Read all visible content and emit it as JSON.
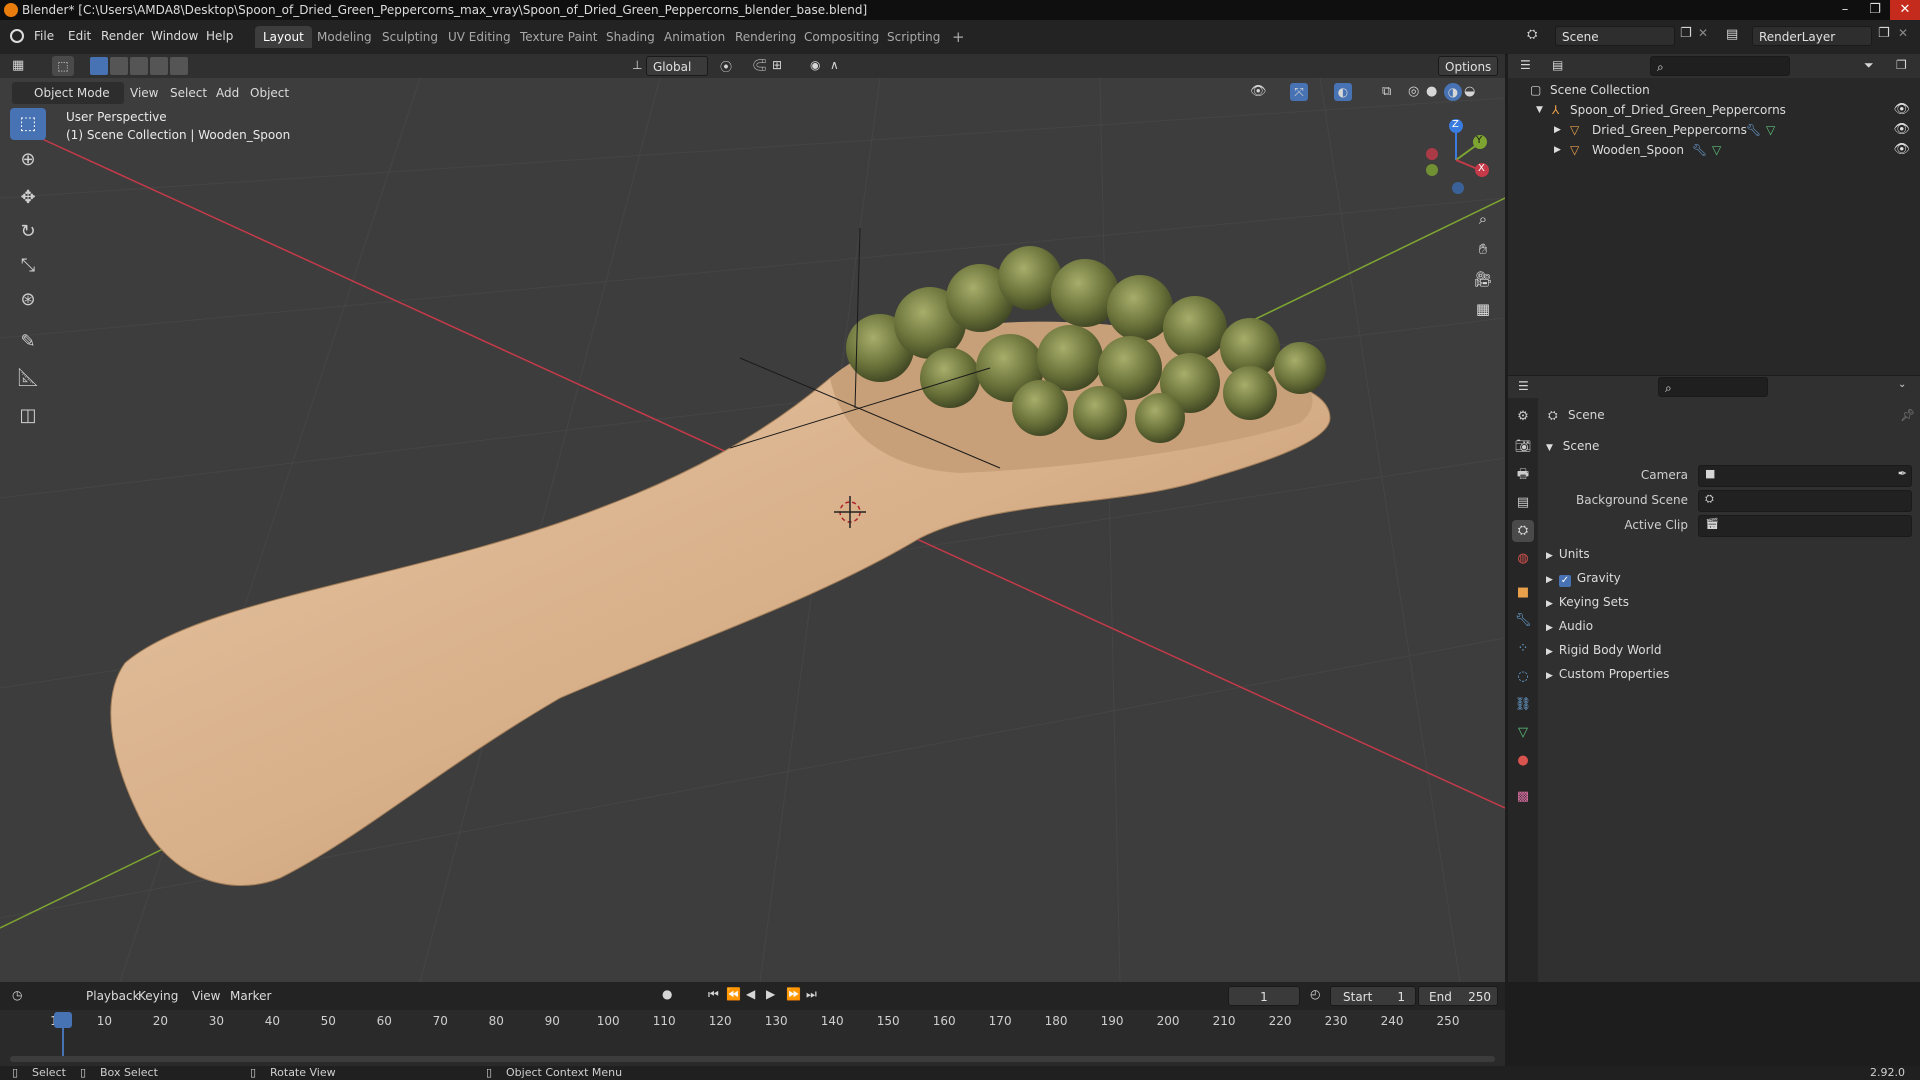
{
  "window": {
    "title": "Blender* [C:\\Users\\AMDA8\\Desktop\\Spoon_of_Dried_Green_Peppercorns_max_vray\\Spoon_of_Dried_Green_Peppercorns_blender_base.blend]"
  },
  "menus": [
    "File",
    "Edit",
    "Render",
    "Window",
    "Help"
  ],
  "workspaces": [
    {
      "label": "Layout",
      "active": true
    },
    {
      "label": "Modeling"
    },
    {
      "label": "Sculpting"
    },
    {
      "label": "UV Editing"
    },
    {
      "label": "Texture Paint"
    },
    {
      "label": "Shading"
    },
    {
      "label": "Animation"
    },
    {
      "label": "Rendering"
    },
    {
      "label": "Compositing"
    },
    {
      "label": "Scripting"
    }
  ],
  "scene_field": "Scene",
  "renderlayer_field": "RenderLayer",
  "toolheader": {
    "orientation": "Global",
    "options_label": "Options"
  },
  "viewport": {
    "mode": "Object Mode",
    "menus": [
      "View",
      "Select",
      "Add",
      "Object"
    ],
    "info_line1": "User Perspective",
    "info_line2": "(1) Scene Collection | Wooden_Spoon",
    "gizmo_axes": {
      "z": "Z",
      "y": "Y",
      "x": "X"
    }
  },
  "outliner": {
    "root": "Scene Collection",
    "collection": "Spoon_of_Dried_Green_Peppercorns",
    "objects": [
      "Dried_Green_Peppercorns",
      "Wooden_Spoon"
    ]
  },
  "properties": {
    "context": "Scene",
    "panel": "Scene",
    "fields": [
      "Camera",
      "Background Scene",
      "Active Clip"
    ],
    "subpanels": [
      "Units",
      "Gravity",
      "Keying Sets",
      "Audio",
      "Rigid Body World",
      "Custom Properties"
    ],
    "gravity_checked": true
  },
  "timeline": {
    "menus": [
      "Playback",
      "Keying",
      "View",
      "Marker"
    ],
    "current_frame": "1",
    "start_label": "Start",
    "start": "1",
    "end_label": "End",
    "end": "250",
    "ticks": [
      "1",
      "10",
      "20",
      "30",
      "40",
      "50",
      "60",
      "70",
      "80",
      "90",
      "100",
      "110",
      "120",
      "130",
      "140",
      "150",
      "160",
      "170",
      "180",
      "190",
      "200",
      "210",
      "220",
      "230",
      "240",
      "250"
    ]
  },
  "statusbar": {
    "select": "Select",
    "box_select": "Box Select",
    "rotate_view": "Rotate View",
    "context_menu": "Object Context Menu",
    "version": "2.92.0"
  },
  "colors": {
    "accent": "#4772b3",
    "x_axis": "#c43a49",
    "y_axis": "#7ea531",
    "z_axis": "#3a7be0",
    "spoon": "#d9b48e",
    "peppercorn": "#6f7a3b"
  }
}
